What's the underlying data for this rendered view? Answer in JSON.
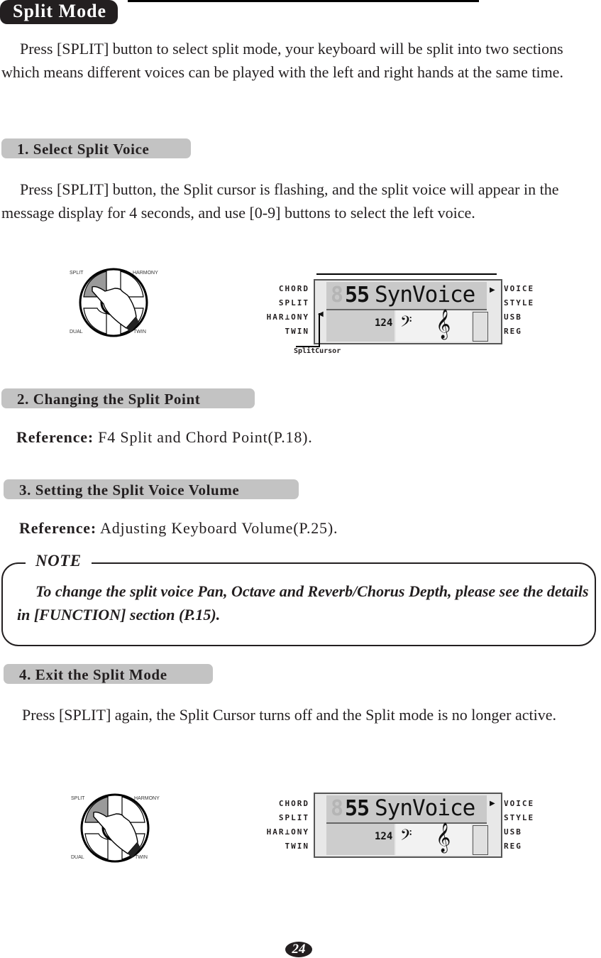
{
  "page": {
    "title": "Split Mode",
    "intro": "Press [SPLIT] button to select split mode, your keyboard will be split into two sections which means different voices can be played with the left and right hands at the same time.",
    "page_number": "24"
  },
  "sections": [
    {
      "heading": "1. Select Split Voice",
      "body": "Press [SPLIT] button, the Split cursor is flashing, and the split voice will appear in the message display for 4 seconds, and use [0-9] buttons to select the left voice."
    },
    {
      "heading": "2. Changing the Split Point",
      "ref_label": "Reference:",
      "ref_text": " F4 Split and Chord Point(P.18)."
    },
    {
      "heading": "3. Setting the Split Voice Volume",
      "ref_label": "Reference:",
      "ref_text": " Adjusting Keyboard Volume(P.25)."
    },
    {
      "heading": "4. Exit the Split Mode",
      "body": "Press [SPLIT] again, the Split Cursor turns off and the Split mode is no longer active."
    }
  ],
  "note": {
    "label": "NOTE",
    "text": "To change the split voice Pan, Octave and Reverb/Chorus Depth, please see the details in [FUNCTION] section (P.15)."
  },
  "wheel": {
    "labels": {
      "top_left": "SPLIT",
      "top_right": "HARMONY",
      "bottom_left": "DUAL",
      "bottom_right": "TWIN"
    }
  },
  "lcd": {
    "left_labels": [
      "CHORD",
      "SPLIT",
      "HAR⊥ONY",
      "TWIN"
    ],
    "right_labels": [
      "VOICE",
      "STYLE",
      "USB",
      "REG"
    ],
    "voice_number": "55",
    "voice_name": "SynVoice",
    "tempo": "124",
    "cursor_label": "SplitCursor",
    "colors": {
      "lcd_bg": "#c9c9c9",
      "segment_dim": "#b5b5b5",
      "segment_on": "#111111"
    }
  }
}
